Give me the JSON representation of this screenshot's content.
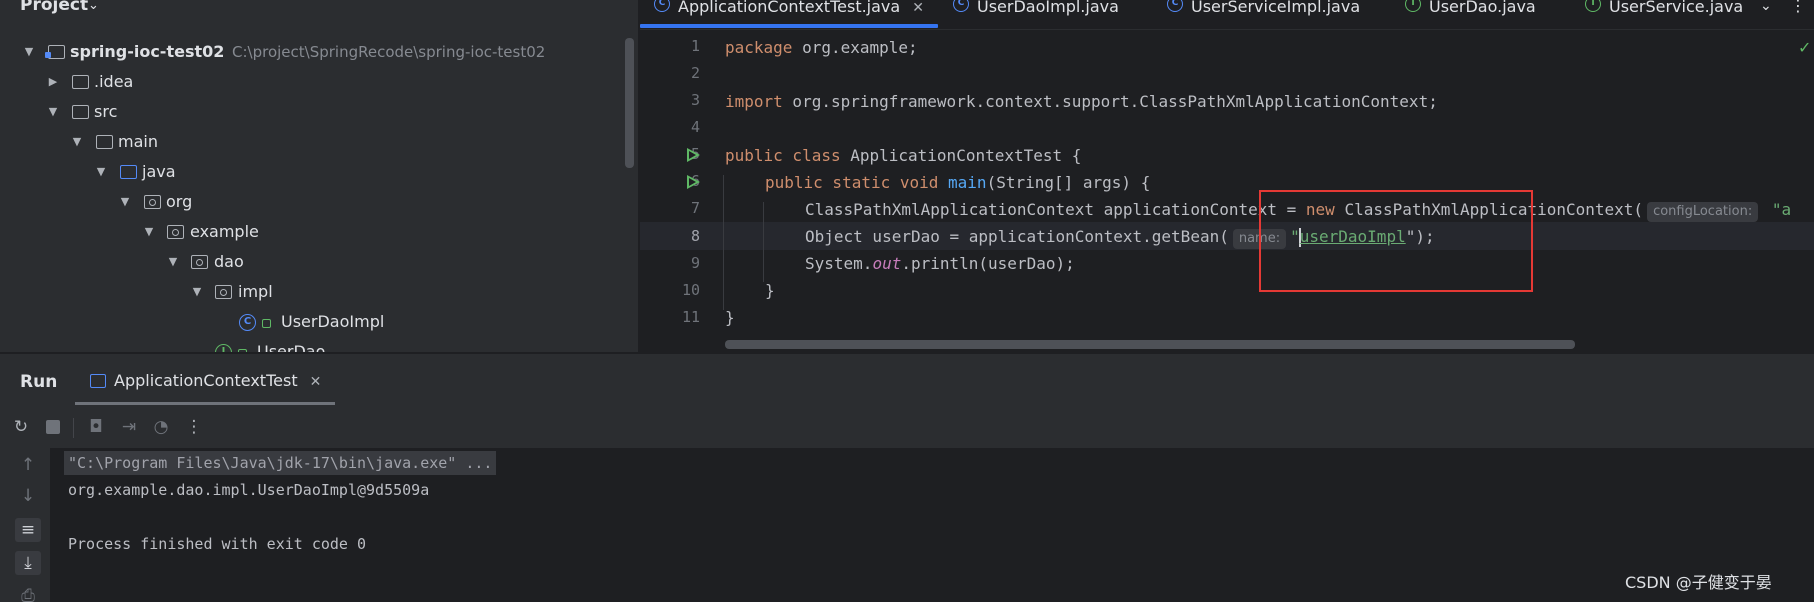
{
  "project_panel": {
    "title": "Project",
    "root": {
      "name": "spring-ioc-test02",
      "path": "C:\\project\\SpringRecode\\spring-ioc-test02"
    },
    "tree": [
      {
        "label": ".idea",
        "expanded": false,
        "icon": "folder-icon"
      },
      {
        "label": "src",
        "expanded": true,
        "icon": "folder-icon"
      },
      {
        "label": "main",
        "expanded": true,
        "icon": "folder-icon"
      },
      {
        "label": "java",
        "expanded": true,
        "icon": "source-folder-icon"
      },
      {
        "label": "org",
        "expanded": true,
        "icon": "package-icon"
      },
      {
        "label": "example",
        "expanded": true,
        "icon": "package-icon"
      },
      {
        "label": "dao",
        "expanded": true,
        "icon": "package-icon"
      },
      {
        "label": "impl",
        "expanded": true,
        "icon": "package-icon"
      },
      {
        "label": "UserDaoImpl",
        "icon": "class-icon"
      },
      {
        "label": "UserDao",
        "icon": "interface-icon"
      }
    ]
  },
  "editor": {
    "tabs": [
      {
        "label": "ApplicationContextTest.java",
        "icon": "class-icon",
        "active": true,
        "closable": true
      },
      {
        "label": "UserDaoImpl.java",
        "icon": "class-icon"
      },
      {
        "label": "UserServiceImpl.java",
        "icon": "class-icon"
      },
      {
        "label": "UserDao.java",
        "icon": "interface-icon"
      },
      {
        "label": "UserService.java",
        "icon": "interface-icon"
      }
    ],
    "line_numbers": [
      "1",
      "2",
      "3",
      "4",
      "5",
      "6",
      "7",
      "8",
      "9",
      "10",
      "11"
    ],
    "current_line": "8",
    "code": {
      "l1_kw": "package",
      "l1_rest": " org.example;",
      "l3_kw": "import",
      "l3_rest": " org.springframework.context.support.ClassPathXmlApplicationContext;",
      "l5_kw": "public class",
      "l5_rest": " ApplicationContextTest {",
      "l6_kw": "public static void",
      "l6_fn": "main",
      "l6_rest": "(String[] args) {",
      "l7_a": "ClassPathXmlApplicationContext applicationContext = ",
      "l7_kw": "new",
      "l7_b": " ClassPathXmlApplicationContext(",
      "l7_hint": "configLocation:",
      "l7_c": " \"a",
      "l8_a": "Object userDao = applicationContext.getBean(",
      "l8_hint": "name:",
      "l8_q": "\"",
      "l8_str1": "u",
      "l8_str2": "serDaoImpl",
      "l8_end": "\");",
      "l9_a": "System.",
      "l9_out": "out",
      "l9_b": ".println(userDao);",
      "l10": "}",
      "l11": "}"
    }
  },
  "run_panel": {
    "title": "Run",
    "tab_label": "ApplicationContextTest",
    "console": [
      "\"C:\\Program Files\\Java\\jdk-17\\bin\\java.exe\" ...",
      "org.example.dao.impl.UserDaoImpl@9d5509a",
      "",
      "Process finished with exit code 0"
    ]
  },
  "watermark": "CSDN @子健变于晏",
  "colors": {
    "accent": "#3574f0",
    "keyword": "#cf8e6d",
    "string": "#6aab73",
    "function": "#56a8f5",
    "highlight_box": "#e53935"
  }
}
